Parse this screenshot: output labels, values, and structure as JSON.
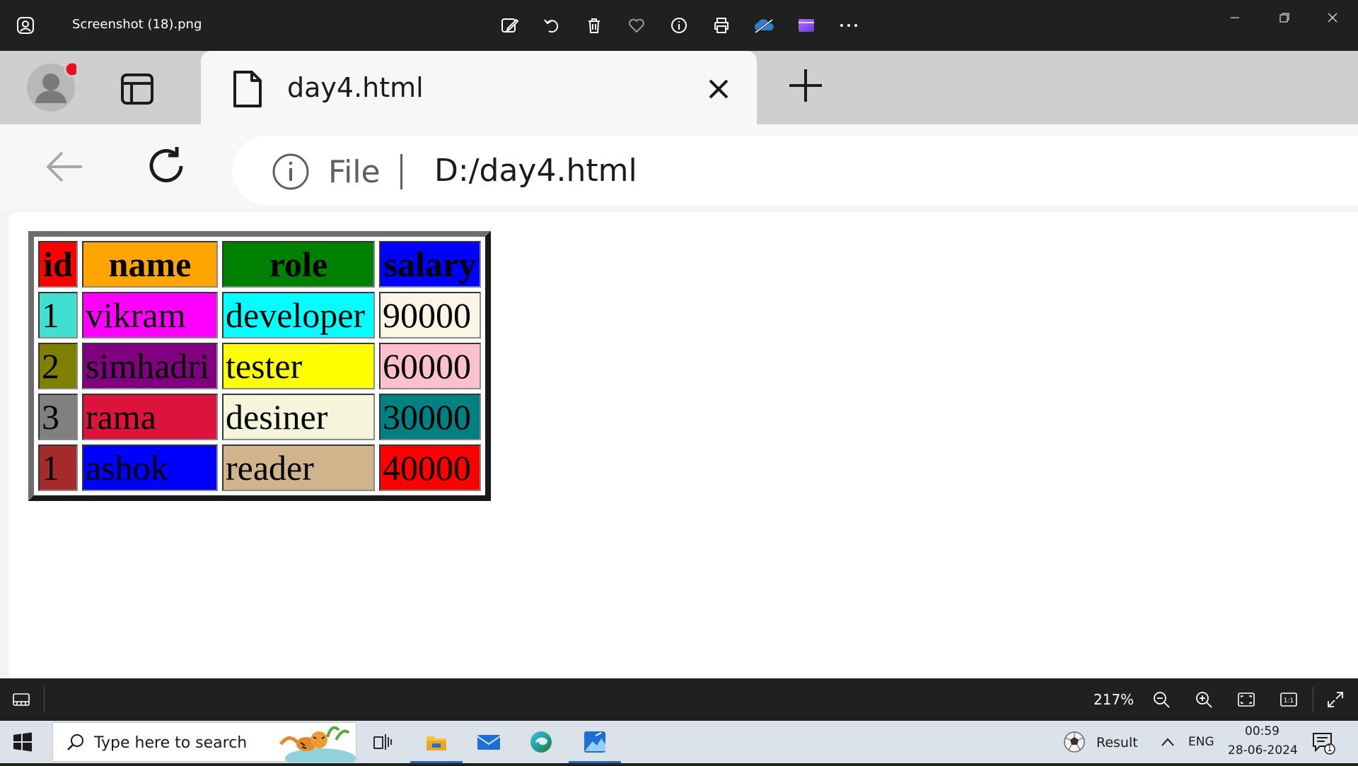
{
  "photos": {
    "file_title": "Screenshot (18).png",
    "zoom": "217%"
  },
  "browser": {
    "tab_title": "day4.html",
    "address_scheme": "File",
    "address_url": "D:/day4.html"
  },
  "table": {
    "headers": [
      {
        "text": "id",
        "bg": "#ff0000"
      },
      {
        "text": "name",
        "bg": "#ffa500"
      },
      {
        "text": "role",
        "bg": "#008000"
      },
      {
        "text": "salary",
        "bg": "#0000ff"
      }
    ],
    "rows": [
      [
        {
          "text": "1",
          "bg": "#40e0d0"
        },
        {
          "text": "vikram",
          "bg": "#ff00ff"
        },
        {
          "text": "developer",
          "bg": "#00ffff"
        },
        {
          "text": "90000",
          "bg": "#fdf5e6"
        }
      ],
      [
        {
          "text": "2",
          "bg": "#808000"
        },
        {
          "text": "simhadri",
          "bg": "#800080"
        },
        {
          "text": "tester",
          "bg": "#ffff00"
        },
        {
          "text": "60000",
          "bg": "#ffc0cb"
        }
      ],
      [
        {
          "text": "3",
          "bg": "#808080"
        },
        {
          "text": "rama",
          "bg": "#dc143c"
        },
        {
          "text": "desiner",
          "bg": "#f5f5dc"
        },
        {
          "text": "30000",
          "bg": "#008080"
        }
      ],
      [
        {
          "text": "1",
          "bg": "#a52a2a"
        },
        {
          "text": "ashok",
          "bg": "#0000ff"
        },
        {
          "text": "reader",
          "bg": "#d2b48c"
        },
        {
          "text": "40000",
          "bg": "#ff0000"
        }
      ]
    ]
  },
  "taskbar": {
    "search_placeholder": "Type here to search",
    "weather_text": "Result",
    "language": "ENG",
    "time": "00:59",
    "date": "28-06-2024",
    "notification_count": "1"
  }
}
